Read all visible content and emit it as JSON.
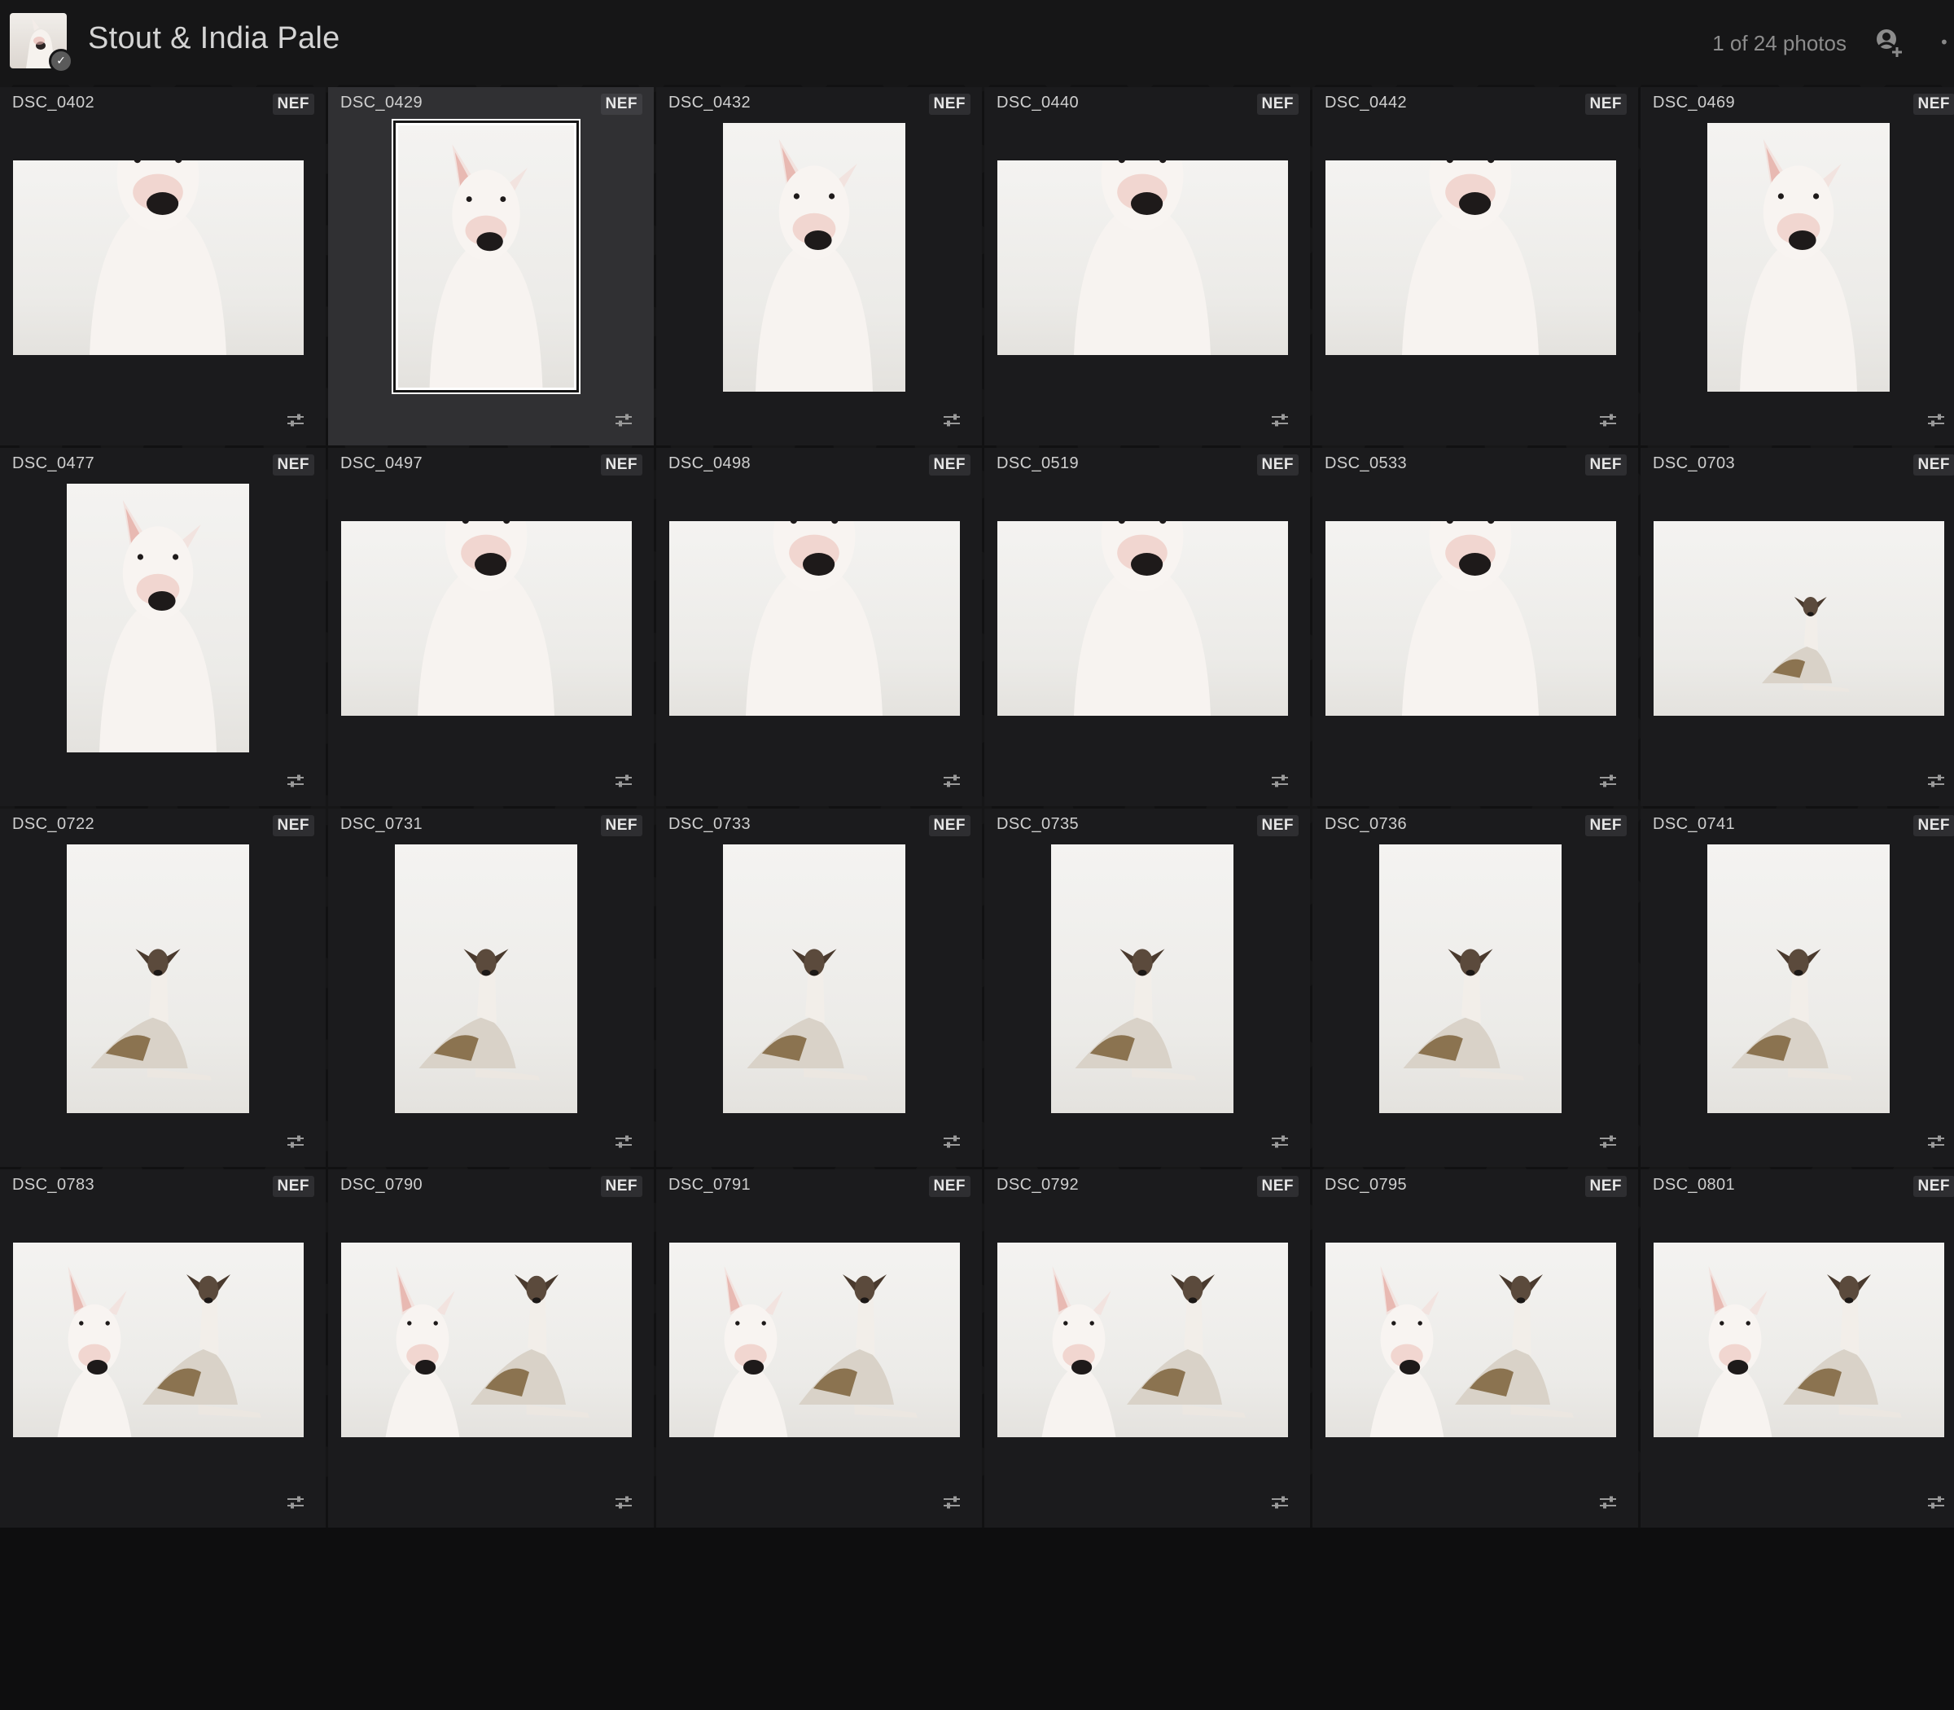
{
  "header": {
    "album_title": "Stout & India Pale",
    "photo_count": "1 of 24 photos",
    "avatar_icon": "dog-avatar-icon",
    "share_icon": "add-person-icon",
    "more_icon": "more-icon"
  },
  "colors": {
    "background": "#111112",
    "cell": "#1c1c1e",
    "cell_selected": "#303033",
    "selection_border": "#ffffff"
  },
  "photos": [
    {
      "name": "DSC_0402",
      "type": "NEF",
      "orient": "land",
      "subject": "bull"
    },
    {
      "name": "DSC_0429",
      "type": "NEF",
      "orient": "port",
      "subject": "bull",
      "selected": true
    },
    {
      "name": "DSC_0432",
      "type": "NEF",
      "orient": "port",
      "subject": "bull"
    },
    {
      "name": "DSC_0440",
      "type": "NEF",
      "orient": "land",
      "subject": "bull"
    },
    {
      "name": "DSC_0442",
      "type": "NEF",
      "orient": "land",
      "subject": "bull"
    },
    {
      "name": "DSC_0469",
      "type": "NEF",
      "orient": "port",
      "subject": "bull"
    },
    {
      "name": "DSC_0477",
      "type": "NEF",
      "orient": "port",
      "subject": "bull"
    },
    {
      "name": "DSC_0497",
      "type": "NEF",
      "orient": "land",
      "subject": "bull"
    },
    {
      "name": "DSC_0498",
      "type": "NEF",
      "orient": "land",
      "subject": "bull"
    },
    {
      "name": "DSC_0519",
      "type": "NEF",
      "orient": "land",
      "subject": "bull"
    },
    {
      "name": "DSC_0533",
      "type": "NEF",
      "orient": "land",
      "subject": "bull"
    },
    {
      "name": "DSC_0703",
      "type": "NEF",
      "orient": "land",
      "subject": "whippet"
    },
    {
      "name": "DSC_0722",
      "type": "NEF",
      "orient": "port",
      "subject": "whippet"
    },
    {
      "name": "DSC_0731",
      "type": "NEF",
      "orient": "port",
      "subject": "whippet"
    },
    {
      "name": "DSC_0733",
      "type": "NEF",
      "orient": "port",
      "subject": "whippet"
    },
    {
      "name": "DSC_0735",
      "type": "NEF",
      "orient": "port",
      "subject": "whippet"
    },
    {
      "name": "DSC_0736",
      "type": "NEF",
      "orient": "port",
      "subject": "whippet"
    },
    {
      "name": "DSC_0741",
      "type": "NEF",
      "orient": "port",
      "subject": "whippet"
    },
    {
      "name": "DSC_0783",
      "type": "NEF",
      "orient": "land",
      "subject": "both"
    },
    {
      "name": "DSC_0790",
      "type": "NEF",
      "orient": "land",
      "subject": "both"
    },
    {
      "name": "DSC_0791",
      "type": "NEF",
      "orient": "land",
      "subject": "both"
    },
    {
      "name": "DSC_0792",
      "type": "NEF",
      "orient": "land",
      "subject": "both"
    },
    {
      "name": "DSC_0795",
      "type": "NEF",
      "orient": "land",
      "subject": "both"
    },
    {
      "name": "DSC_0801",
      "type": "NEF",
      "orient": "land",
      "subject": "both"
    }
  ]
}
